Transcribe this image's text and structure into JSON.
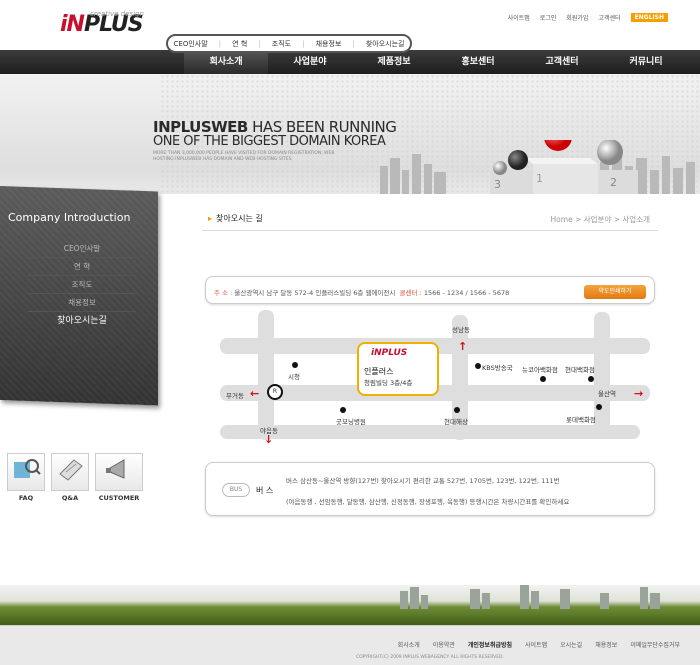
{
  "header": {
    "logo_tagline": "creative design",
    "logo_pre": "iN",
    "logo_main": "PLUS",
    "utility": [
      "사이트맵",
      "로그인",
      "회원가입",
      "고객센터"
    ],
    "english": "ENGLISH"
  },
  "subnav": [
    "CEO인사말",
    "연 혁",
    "조직도",
    "채용정보",
    "찾아오시는길"
  ],
  "mainnav": [
    "회사소개",
    "사업분야",
    "제품정보",
    "홍보센터",
    "고객센터",
    "커뮤니티"
  ],
  "banner": {
    "line1_bold": "INPLUSWEB",
    "line1_rest": "HAS BEEN RUNNING",
    "line2": "ONE OF THE BIGGEST DOMAIN KOREA",
    "small": "MORE THAN 3,000,000 PEOPLE HAVE VISITED FOR DOMAIN REGISTRATION, WEB HOSTING INPLUSWEB HAS DOMAIN AND WEB HOSTING SITES"
  },
  "sidebar": {
    "title": "Company Introduction",
    "items": [
      "CEO인사말",
      "연 혁",
      "조직도",
      "채용정보",
      "찾아오시는길"
    ]
  },
  "quick": [
    "FAQ",
    "Q&A",
    "CUSTOMER"
  ],
  "page": {
    "title": "찾아오시는 길",
    "breadcrumb": "Home > 사업분야 > 사업소개"
  },
  "address": {
    "label": "주 소 :",
    "text": "울산광역시 남구 달동 572-4 인플러스빌딩 6층 웹에이전시",
    "call_label": "콜센터 :",
    "call": "1566 - 1234 / 1566 - 5678",
    "print_button": "약도인쇄하기"
  },
  "map": {
    "pin_brand": "iNPLUS",
    "pin_name": "인플러스",
    "pin_building": "청림빌딩 3층/4층",
    "labels": {
      "seongnam": "성남동",
      "sicheong": "시청",
      "kbs": "KBS방송국",
      "newcore": "뉴코아백화점",
      "hyundai_dept": "현대백화점",
      "mugeodong": "무거동",
      "ulsan_station": "울산역",
      "gukmin": "굿모닝병원",
      "hyundai_haesang": "현대해상",
      "lotte": "롯데백화점",
      "yaeumdong": "야음동"
    }
  },
  "bus": {
    "badge": "BUS",
    "head": "버 스",
    "line1": "버스 삼산동~울산역 방향(127번) 찾아오시기 편리한 교통 527번, 1705번, 123번, 122번, 111번",
    "line2": "(야음동행 , 선암동행, 달동행, 삼산행, 신정동행, 장생포행, 옥동행) 등행시간은  차량시간표를 확인하세요"
  },
  "footer": {
    "links": [
      "회사소개",
      "이용약관",
      "개인정보취급방침",
      "사이트맵",
      "오시는길",
      "채용정보",
      "이메일무단수집거부"
    ],
    "copyright": "COPYRIGHT(C) 2009 INPLUS WEBAGENCY ALL RIGHTS RESERVED."
  }
}
